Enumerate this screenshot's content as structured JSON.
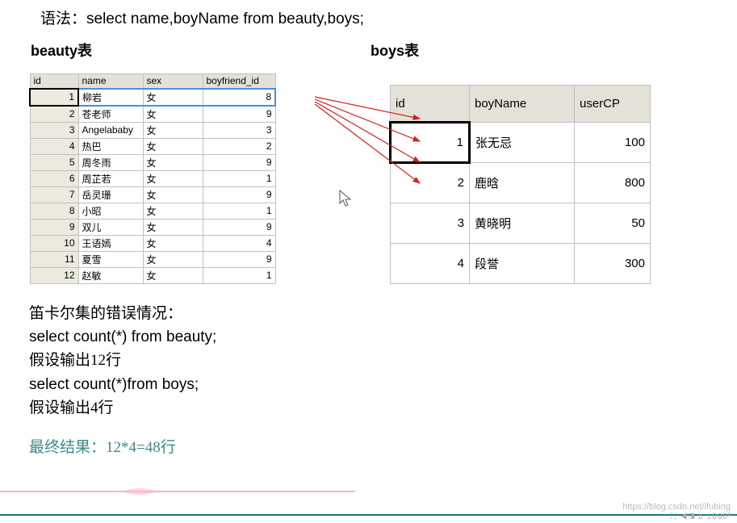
{
  "syntax": "语法：select  name,boyName from beauty,boys;",
  "beauty_title": "beauty表",
  "boys_title": "boys表",
  "beauty": {
    "headers": {
      "id": "id",
      "name": "name",
      "sex": "sex",
      "bf": "boyfriend_id"
    },
    "rows": [
      {
        "id": "1",
        "name": "柳岩",
        "sex": "女",
        "bf": "8"
      },
      {
        "id": "2",
        "name": "苍老师",
        "sex": "女",
        "bf": "9"
      },
      {
        "id": "3",
        "name": "Angelababy",
        "sex": "女",
        "bf": "3"
      },
      {
        "id": "4",
        "name": "热巴",
        "sex": "女",
        "bf": "2"
      },
      {
        "id": "5",
        "name": "周冬雨",
        "sex": "女",
        "bf": "9"
      },
      {
        "id": "6",
        "name": "周芷若",
        "sex": "女",
        "bf": "1"
      },
      {
        "id": "7",
        "name": "岳灵珊",
        "sex": "女",
        "bf": "9"
      },
      {
        "id": "8",
        "name": "小昭",
        "sex": "女",
        "bf": "1"
      },
      {
        "id": "9",
        "name": "双儿",
        "sex": "女",
        "bf": "9"
      },
      {
        "id": "10",
        "name": "王语嫣",
        "sex": "女",
        "bf": "4"
      },
      {
        "id": "11",
        "name": "夏雪",
        "sex": "女",
        "bf": "9"
      },
      {
        "id": "12",
        "name": "赵敏",
        "sex": "女",
        "bf": "1"
      }
    ]
  },
  "boys": {
    "headers": {
      "id": "id",
      "name": "boyName",
      "cp": "userCP"
    },
    "rows": [
      {
        "id": "1",
        "name": "张无忌",
        "cp": "100"
      },
      {
        "id": "2",
        "name": "鹿晗",
        "cp": "800"
      },
      {
        "id": "3",
        "name": "黄晓明",
        "cp": "50"
      },
      {
        "id": "4",
        "name": "段誉",
        "cp": "300"
      }
    ]
  },
  "notes": {
    "l1": "笛卡尔集的错误情况：",
    "l2": "select count(*) from beauty;",
    "l3": "假设输出12行",
    "l4": "select count(*)from boys;",
    "l5": "假设输出4行"
  },
  "final": "最终结果：12*4=48行",
  "watermark": "https://blog.csdn.net/ifubing",
  "corner": "⛶ ◀◨ ᴅ  1080ᴾ"
}
